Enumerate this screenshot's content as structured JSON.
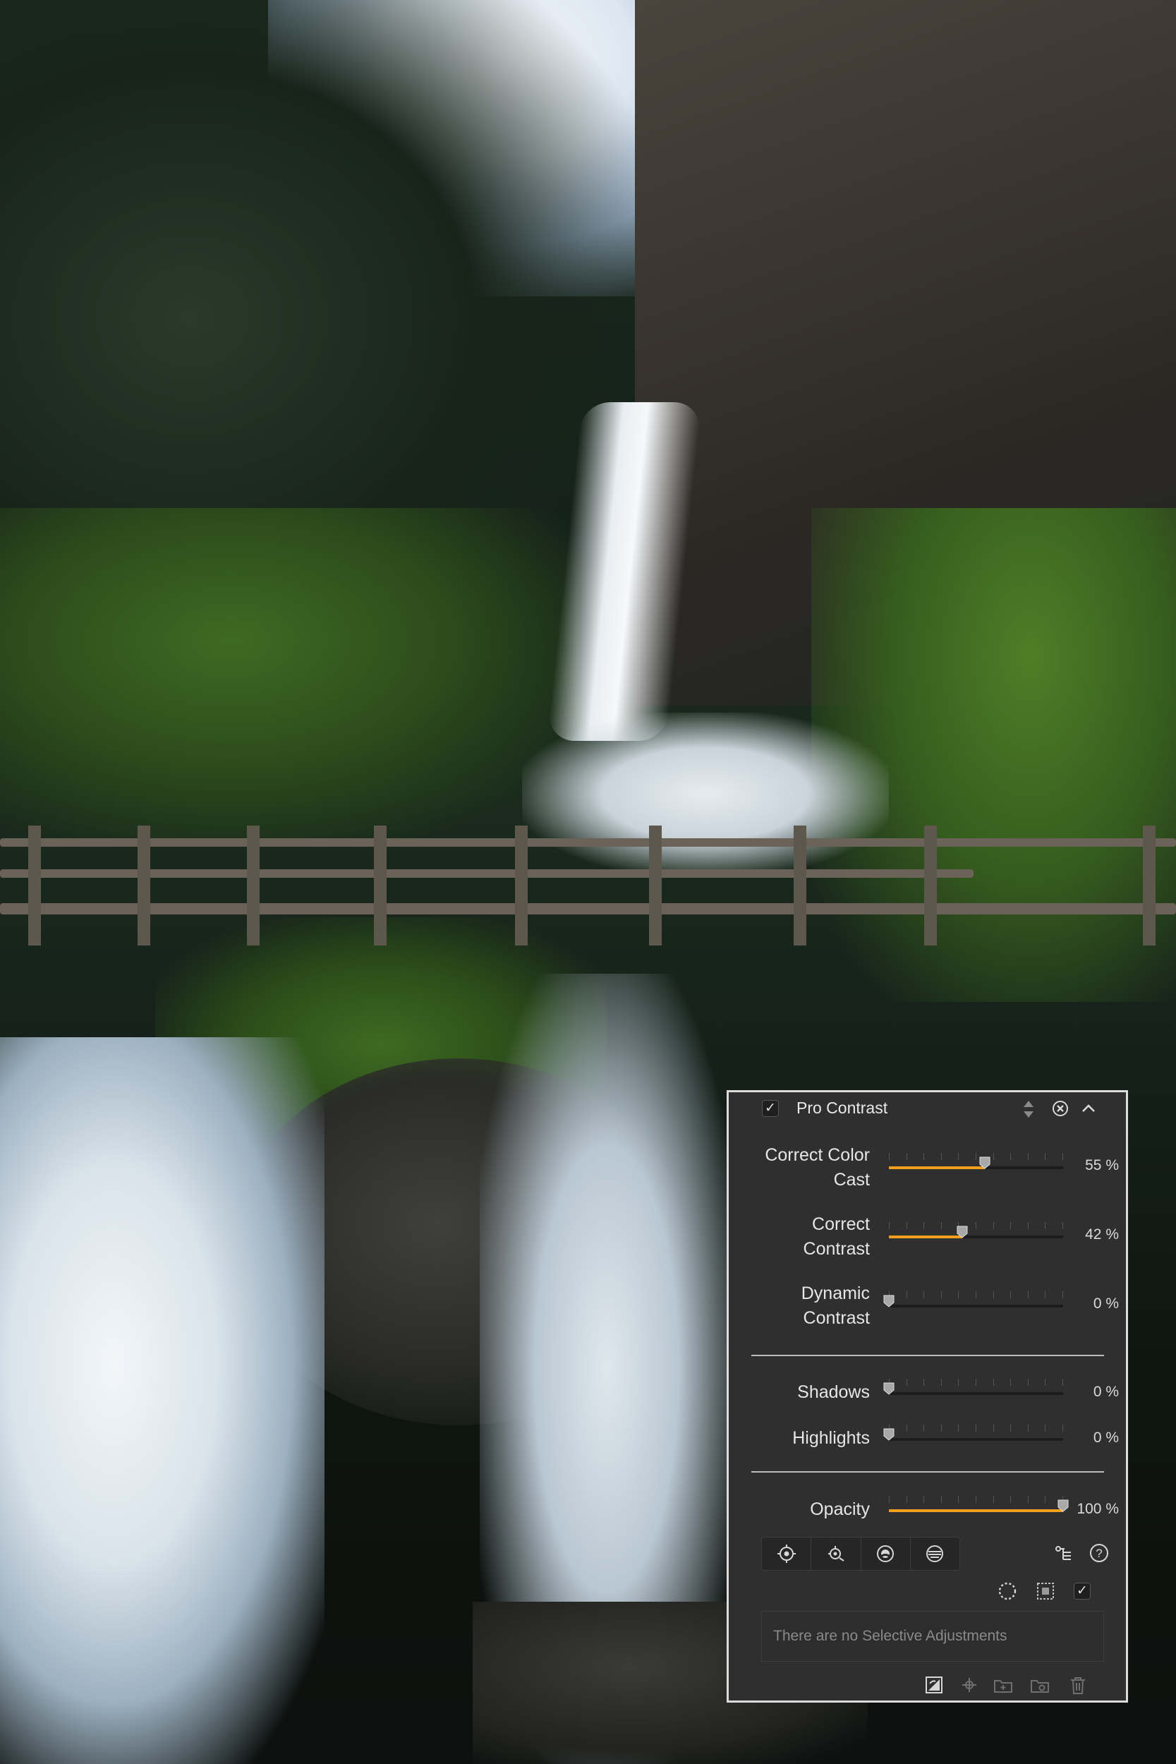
{
  "photo": {
    "subject_icon": "waterfall-landscape-photo"
  },
  "panel": {
    "title": "Pro Contrast",
    "enabled": true,
    "accent_color": "#f0a01e",
    "sliders": [
      {
        "id": "correct-color-cast",
        "label_line1": "Correct Color",
        "label_line2": "Cast",
        "value": 55,
        "display": "55 %"
      },
      {
        "id": "correct-contrast",
        "label_line1": "Correct",
        "label_line2": "Contrast",
        "value": 42,
        "display": "42 %"
      },
      {
        "id": "dynamic-contrast",
        "label_line1": "Dynamic",
        "label_line2": "Contrast",
        "value": 0,
        "display": "0 %"
      },
      {
        "id": "shadows",
        "label_line1": "Shadows",
        "label_line2": "",
        "value": 0,
        "display": "0 %"
      },
      {
        "id": "highlights",
        "label_line1": "Highlights",
        "label_line2": "",
        "value": 0,
        "display": "0 %"
      },
      {
        "id": "opacity",
        "label_line1": "Opacity",
        "label_line2": "",
        "value": 100,
        "display": "100 %"
      }
    ],
    "selective_message": "There are no Selective Adjustments",
    "tool_icons": [
      "control-point-icon",
      "color-point-icon",
      "brush-icon",
      "gradient-icon"
    ],
    "side_icons": [
      "settings-list-icon",
      "help-icon"
    ],
    "view_icons": [
      "lasso-selection-icon",
      "mask-view-icon",
      "apply-check-icon"
    ],
    "footer_icons": [
      "fill-remove-icon",
      "add-point-icon",
      "add-group-icon",
      "duplicate-icon",
      "trash-icon"
    ]
  }
}
